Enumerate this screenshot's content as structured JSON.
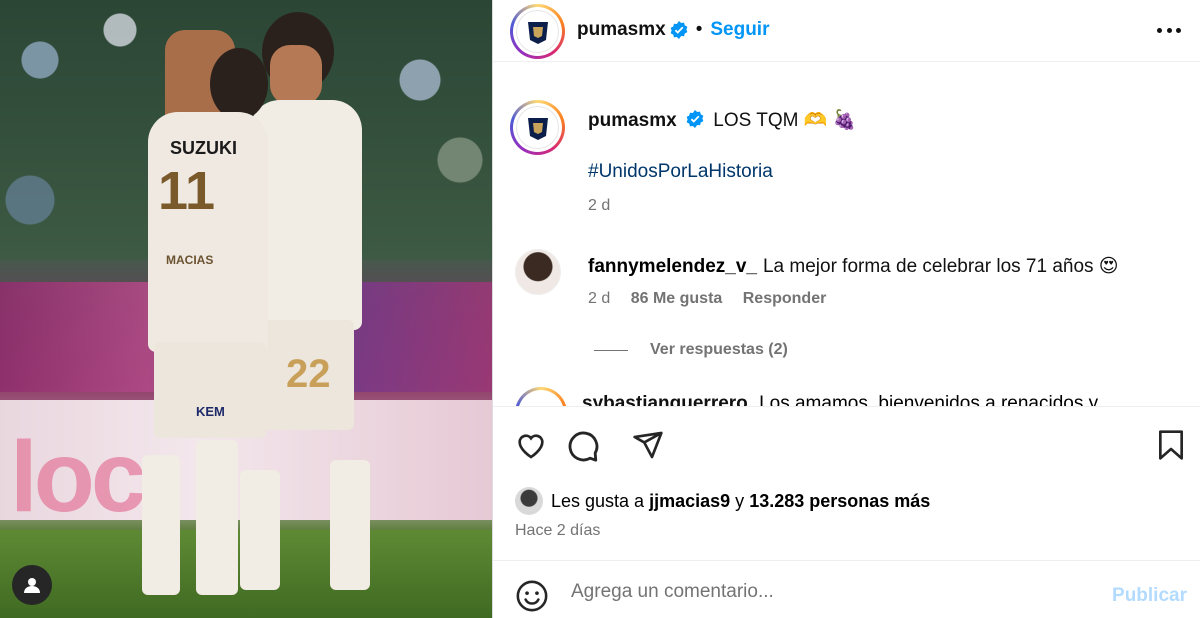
{
  "post": {
    "author": "pumasmx",
    "follow_label": "Seguir",
    "separator": "•"
  },
  "caption": {
    "author": "pumasmx",
    "text": "LOS TQM 🫶 🍇",
    "hashtag": "#UnidosPorLaHistoria",
    "time": "2 d"
  },
  "comments": [
    {
      "user": "fannymelendez_v_",
      "text": "La mejor forma de celebrar los 71 años 😍",
      "time": "2 d",
      "likes": "86 Me gusta",
      "reply_label": "Responder",
      "view_replies": "Ver respuestas (2)"
    },
    {
      "user": "sybastianguerrero",
      "text": "Los amamos, bienvenidos a renacidos y"
    }
  ],
  "likes": {
    "prefix": "Les gusta a",
    "user": "jjmacias9",
    "conj": "y",
    "others": "13.283 personas más",
    "posted": "Hace 2 días"
  },
  "composer": {
    "placeholder": "Agrega un comentario...",
    "publish_label": "Publicar"
  },
  "photo": {
    "jersey_sponsor": "SUZUKI",
    "number_front": "11",
    "number_back": "22",
    "shorts_sponsor": "KEM",
    "name": "MACIAS",
    "banner_text": "loc"
  },
  "colors": {
    "accent_blue": "#0095f6",
    "hashtag": "#00376b",
    "muted": "#737373",
    "publish_disabled": "#b3dbff"
  }
}
